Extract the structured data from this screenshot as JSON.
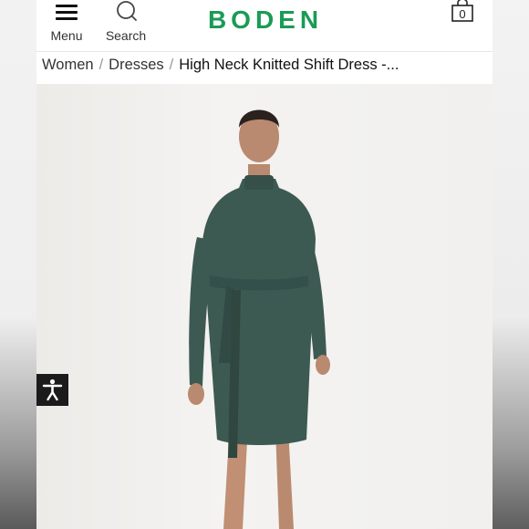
{
  "header": {
    "menu_label": "Menu",
    "search_label": "Search",
    "brand": "BODEN",
    "bag_count": "0"
  },
  "breadcrumb": {
    "items": [
      "Women",
      "Dresses"
    ],
    "current": "High Neck Knitted Shift Dress -..."
  },
  "product": {
    "dress_color": "#3c5a52"
  },
  "colors": {
    "brand": "#1a9b55",
    "accessibility_button": "#1b1b1b"
  }
}
